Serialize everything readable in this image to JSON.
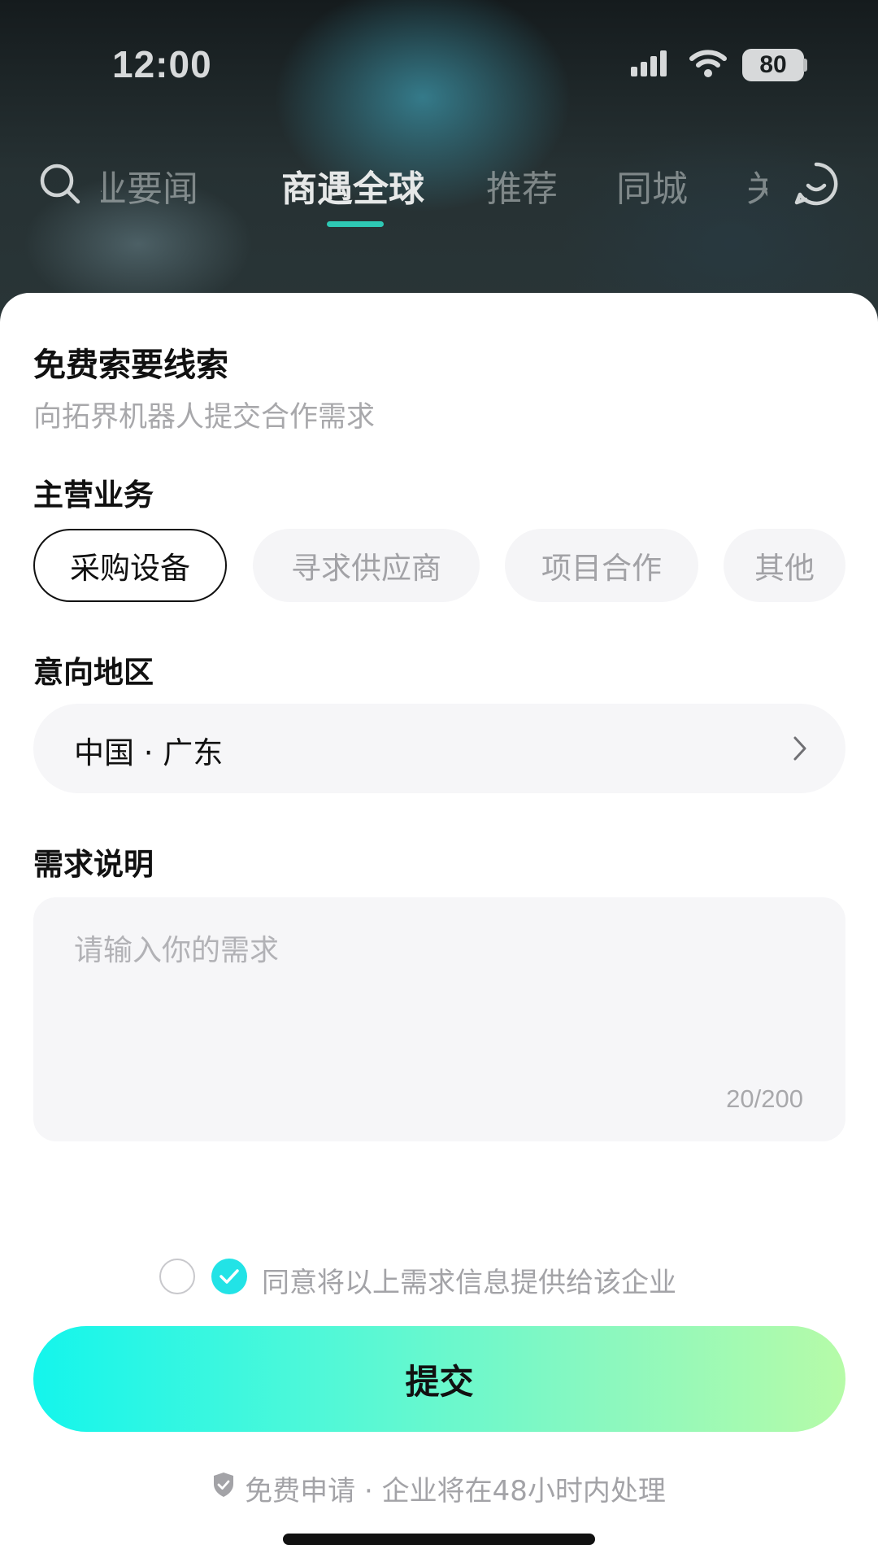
{
  "status_bar": {
    "time": "12:00",
    "battery": "80",
    "icons": [
      "cellular-signal-icon",
      "wifi-icon",
      "battery-icon"
    ]
  },
  "top_nav": {
    "tabs": [
      {
        "label": "行业要闻",
        "active": false
      },
      {
        "label": "商遇全球",
        "active": true
      },
      {
        "label": "推荐",
        "active": false
      },
      {
        "label": "同城",
        "active": false
      },
      {
        "label": "关注",
        "active": false
      }
    ],
    "left_icon": "search-icon",
    "right_icon": "message-icon",
    "accent": "#2ec8b4"
  },
  "form": {
    "title": "免费索要线索",
    "subtitle": "向拓界机器人提交合作需求",
    "business_label": "主营业务",
    "business_options": [
      {
        "label": "采购设备",
        "selected": true
      },
      {
        "label": "寻求供应商",
        "selected": false
      },
      {
        "label": "项目合作",
        "selected": false
      },
      {
        "label": "其他",
        "selected": false
      }
    ],
    "region_label": "意向地区",
    "region_value": "中国 · 广东",
    "description_label": "需求说明",
    "description_placeholder": "请输入你的需求",
    "description_counter": "20/200",
    "agree_text": "同意将以上需求信息提供给该企业",
    "submit_label": "提交",
    "footer_note": "免费申请 · 企业将在48小时内处理"
  },
  "colors": {
    "submit_gradient_start": "#14f5ec",
    "submit_gradient_end": "#b6fba8",
    "check_color": "#22e3e6"
  }
}
